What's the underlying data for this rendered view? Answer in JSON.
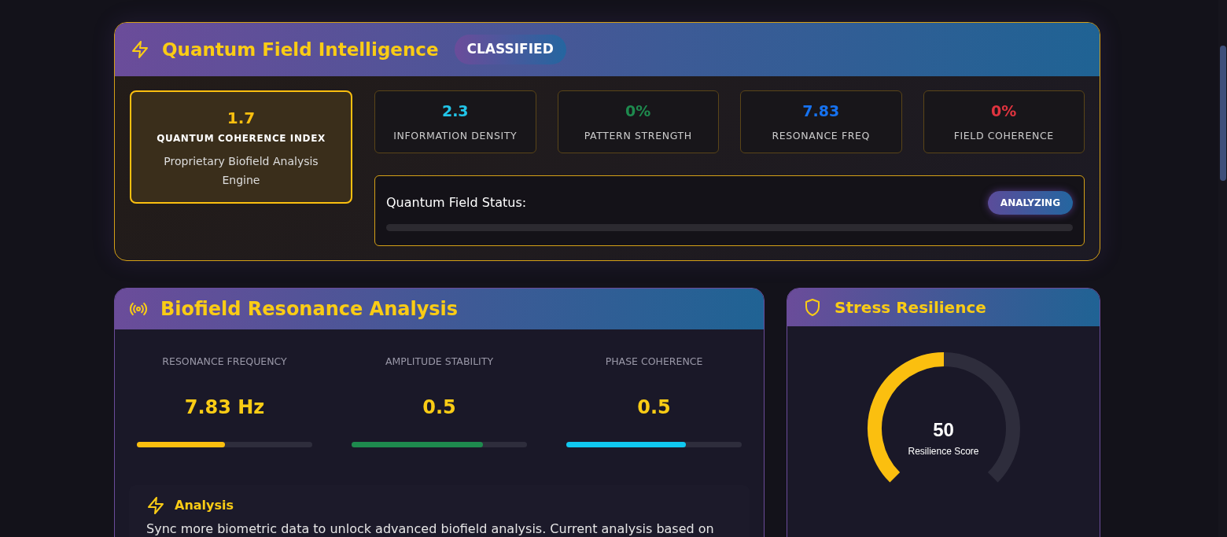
{
  "quantum": {
    "title": "Quantum Field Intelligence",
    "badge": "CLASSIFIED",
    "index": {
      "value": "1.7",
      "label": "QUANTUM COHERENCE INDEX",
      "caption": "Proprietary Biofield Analysis Engine"
    },
    "stats": [
      {
        "value": "2.3",
        "label": "INFORMATION DENSITY",
        "color": "#22c5e8"
      },
      {
        "value": "0%",
        "label": "PATTERN STRENGTH",
        "color": "#1e8a4e"
      },
      {
        "value": "7.83",
        "label": "RESONANCE FREQ",
        "color": "#1672f0"
      },
      {
        "value": "0%",
        "label": "FIELD COHERENCE",
        "color": "#e0343f"
      }
    ],
    "status": {
      "label": "Quantum Field Status:",
      "badge": "ANALYZING"
    }
  },
  "biofield": {
    "title": "Biofield Resonance Analysis",
    "metrics": [
      {
        "label": "RESONANCE FREQUENCY",
        "value": "7.83 Hz",
        "level": 0.5,
        "color": "#fbbf0f"
      },
      {
        "label": "AMPLITUDE STABILITY",
        "value": "0.5",
        "level": 0.75,
        "color": "#1e8a4e"
      },
      {
        "label": "PHASE COHERENCE",
        "value": "0.5",
        "level": 0.68,
        "color": "#10c8f0"
      }
    ],
    "analysis": {
      "title": "Analysis",
      "text": "Sync more biometric data to unlock advanced biofield analysis. Current analysis based on"
    }
  },
  "stress": {
    "title": "Stress Resilience",
    "score": "50",
    "score_label": "Resilience Score",
    "level": 0.5
  }
}
